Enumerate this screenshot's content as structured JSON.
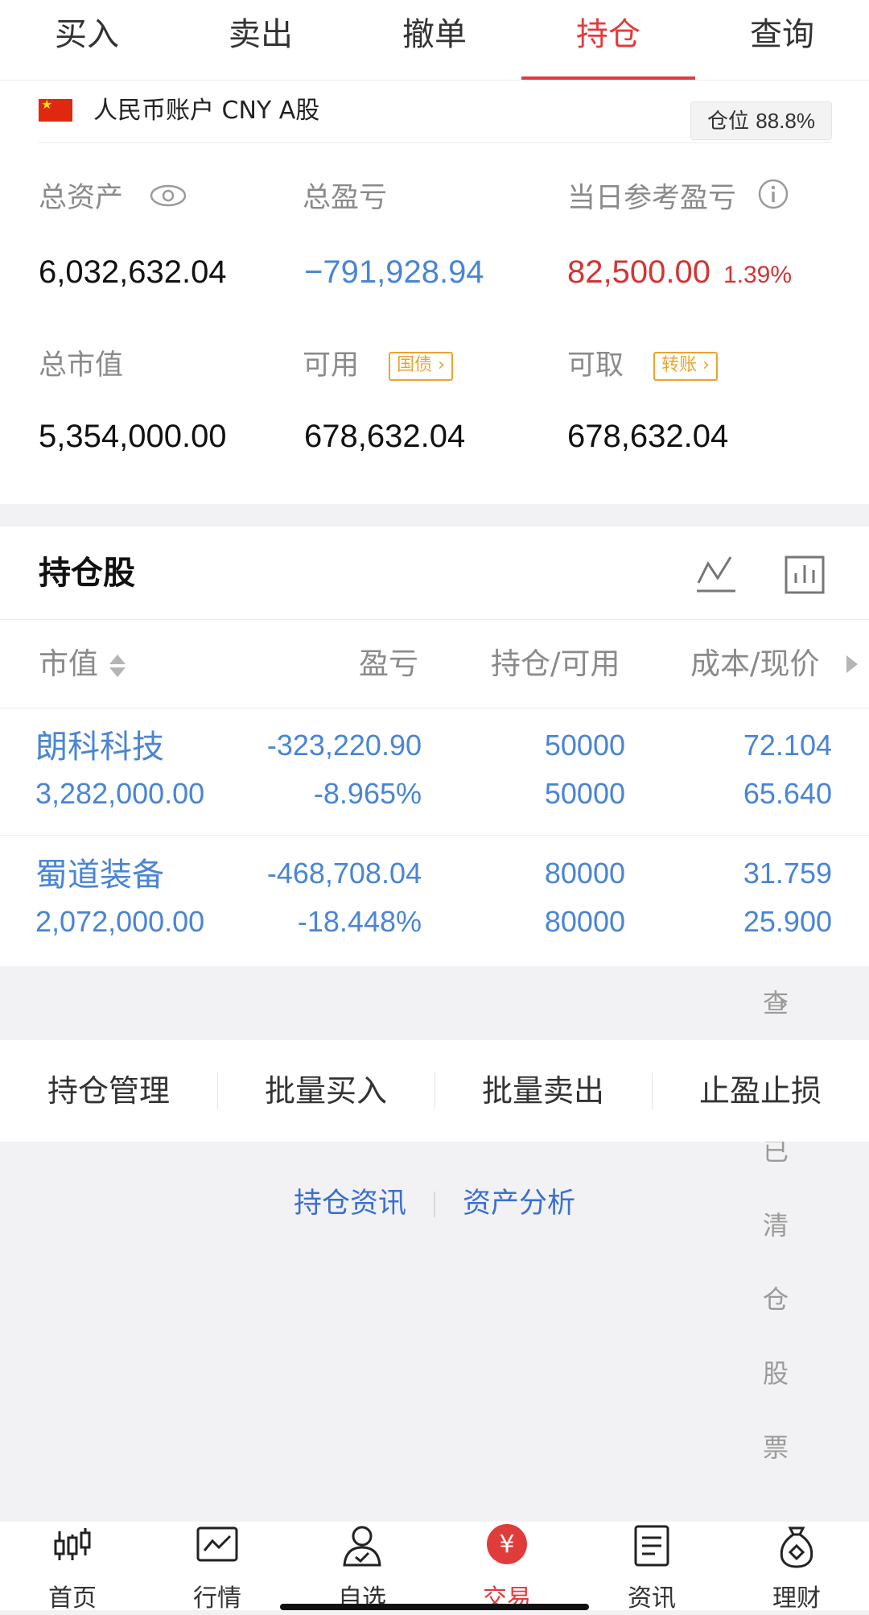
{
  "tabs": [
    {
      "label": "买入"
    },
    {
      "label": "卖出"
    },
    {
      "label": "撤单"
    },
    {
      "label": "持仓",
      "active": true
    },
    {
      "label": "查询"
    }
  ],
  "account": {
    "name": "人民币账户 CNY A股",
    "position_label": "仓位",
    "position_value": "88.8%",
    "total_assets_label": "总资产",
    "total_assets": "6,032,632.04",
    "total_pnl_label": "总盈亏",
    "total_pnl": "−791,928.94",
    "daily_pnl_label": "当日参考盈亏",
    "daily_pnl": "82,500.00",
    "daily_pnl_pct": "1.39%",
    "market_value_label": "总市值",
    "market_value": "5,354,000.00",
    "available_label": "可用",
    "available_tag": "国债",
    "available": "678,632.04",
    "withdrawable_label": "可取",
    "withdrawable_tag": "转账",
    "withdrawable": "678,632.04"
  },
  "holdings": {
    "title": "持仓股",
    "columns": [
      "市值",
      "盈亏",
      "持仓/可用",
      "成本/现价"
    ],
    "rows": [
      {
        "name": "朗科科技",
        "market_value": "3,282,000.00",
        "pnl": "-323,220.90",
        "pnl_pct": "-8.965%",
        "position": "50000",
        "available": "50000",
        "cost": "72.104",
        "price": "65.640"
      },
      {
        "name": "蜀道装备",
        "market_value": "2,072,000.00",
        "pnl": "-468,708.04",
        "pnl_pct": "-18.448%",
        "position": "80000",
        "available": "80000",
        "cost": "31.759",
        "price": "25.900"
      }
    ]
  },
  "cleared_link": "查看已清仓股票",
  "actions": [
    "持仓管理",
    "批量买入",
    "批量卖出",
    "止盈止损"
  ],
  "links": [
    "持仓资讯",
    "资产分析"
  ],
  "bottom_nav": [
    {
      "label": "首页",
      "icon": "candlestick-icon"
    },
    {
      "label": "行情",
      "icon": "chart-icon"
    },
    {
      "label": "自选",
      "icon": "user-check-icon"
    },
    {
      "label": "交易",
      "icon": "yuan-icon",
      "active": true
    },
    {
      "label": "资讯",
      "icon": "document-icon"
    },
    {
      "label": "理财",
      "icon": "money-bag-icon"
    }
  ],
  "colors": {
    "accent": "#e03c3c",
    "link_blue": "#4a85d3",
    "tag_orange": "#e9a431"
  }
}
